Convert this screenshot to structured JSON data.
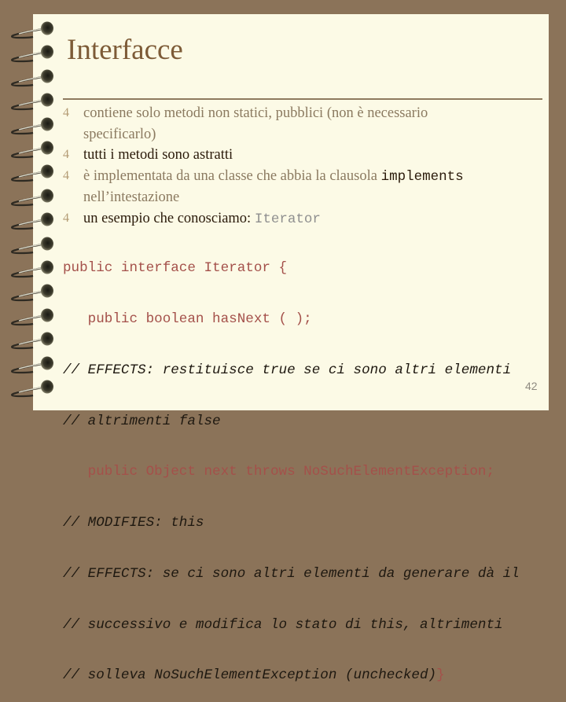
{
  "slide": {
    "title": "Interfacce",
    "page_number": "42",
    "bullet_glyph": "4",
    "bullets": [
      {
        "style": "muted",
        "text": "contiene solo metodi non statici, pubblici (non è necessario",
        "continuation": "specificarlo)"
      },
      {
        "style": "dark",
        "text": "tutti i metodi sono astratti"
      },
      {
        "style": "muted",
        "text": "è implementata da una classe che abbia la clausola ",
        "code": "implements",
        "continuation": "nell’intestazione"
      },
      {
        "style": "dark",
        "text": "un esempio che conosciamo: ",
        "code": "Iterator"
      }
    ],
    "code_lines": [
      {
        "type": "code",
        "text": "public interface Iterator {"
      },
      {
        "type": "code",
        "text": "   public boolean hasNext ( );"
      },
      {
        "type": "comment",
        "text": "// EFFECTS: restituisce true se ci sono altri elementi"
      },
      {
        "type": "comment",
        "text": "// altrimenti false"
      },
      {
        "type": "code",
        "text": "   public Object next throws NoSuchElementException;"
      },
      {
        "type": "comment",
        "text": "// MODIFIES: this"
      },
      {
        "type": "comment",
        "text": "// EFFECTS: se ci sono altri elementi da generare dà il"
      },
      {
        "type": "comment",
        "text": "// successivo e modifica lo stato di this, altrimenti"
      },
      {
        "type": "comment",
        "text": "// solleva NoSuchElementException (unchecked)",
        "tail_code": "}"
      }
    ]
  },
  "decor": {
    "spiral_ring_icon": "spiral-binding-ring",
    "ring_count": 16
  },
  "colors": {
    "background": "#8b7359",
    "page": "#fcfae6",
    "title": "#7d5b37",
    "bullet_mark": "#b39b74",
    "muted_text": "#8b7a60",
    "dark_text": "#2a1a0a",
    "code_keyword": "#a4504a",
    "comment": "#1e1810"
  }
}
